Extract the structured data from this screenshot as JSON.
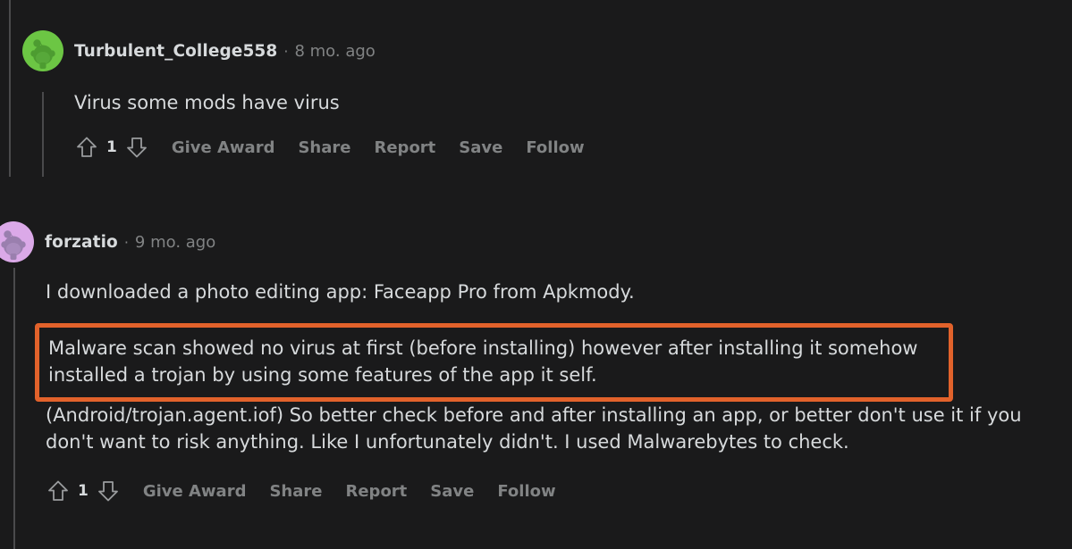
{
  "theme": {
    "background": "#1a1a1b",
    "text_primary": "#d7dadc",
    "text_secondary": "#818384",
    "highlight_border": "#e2622b",
    "thread_line": "#4a4a4c"
  },
  "comments": [
    {
      "id": "comment-1",
      "avatar": {
        "name": "reddit-snoo-avatar-green",
        "circle_color": "#6cc644",
        "figure_color": "#4a9c2d"
      },
      "username": "Turbulent_College558",
      "separator": "·",
      "timestamp": "8 mo. ago",
      "paragraphs": [
        "Virus some mods have virus"
      ],
      "highlight": null,
      "actions": {
        "upvote_icon": "arrow-up-icon",
        "vote_count": "1",
        "downvote_icon": "arrow-down-icon",
        "links": [
          "Give Award",
          "Share",
          "Report",
          "Save",
          "Follow"
        ]
      }
    },
    {
      "id": "comment-2",
      "avatar": {
        "name": "reddit-snoo-avatar-purple",
        "circle_color": "#d9a9e8",
        "figure_color": "#9b7fb0"
      },
      "username": "forzatio",
      "separator": "·",
      "timestamp": "9 mo. ago",
      "paragraphs": [
        "I downloaded a photo editing app: Faceapp Pro from Apkmody.",
        "(Android/trojan.agent.iof) So better check before and after installing an app, or better don't use it if you don't want to risk anything. Like I unfortunately didn't. I used Malwarebytes to check."
      ],
      "highlight": {
        "text": "Malware scan showed no virus at first (before installing) however after installing it somehow installed a trojan by using some features of the app it self."
      },
      "actions": {
        "upvote_icon": "arrow-up-icon",
        "vote_count": "1",
        "downvote_icon": "arrow-down-icon",
        "links": [
          "Give Award",
          "Share",
          "Report",
          "Save",
          "Follow"
        ]
      }
    }
  ]
}
